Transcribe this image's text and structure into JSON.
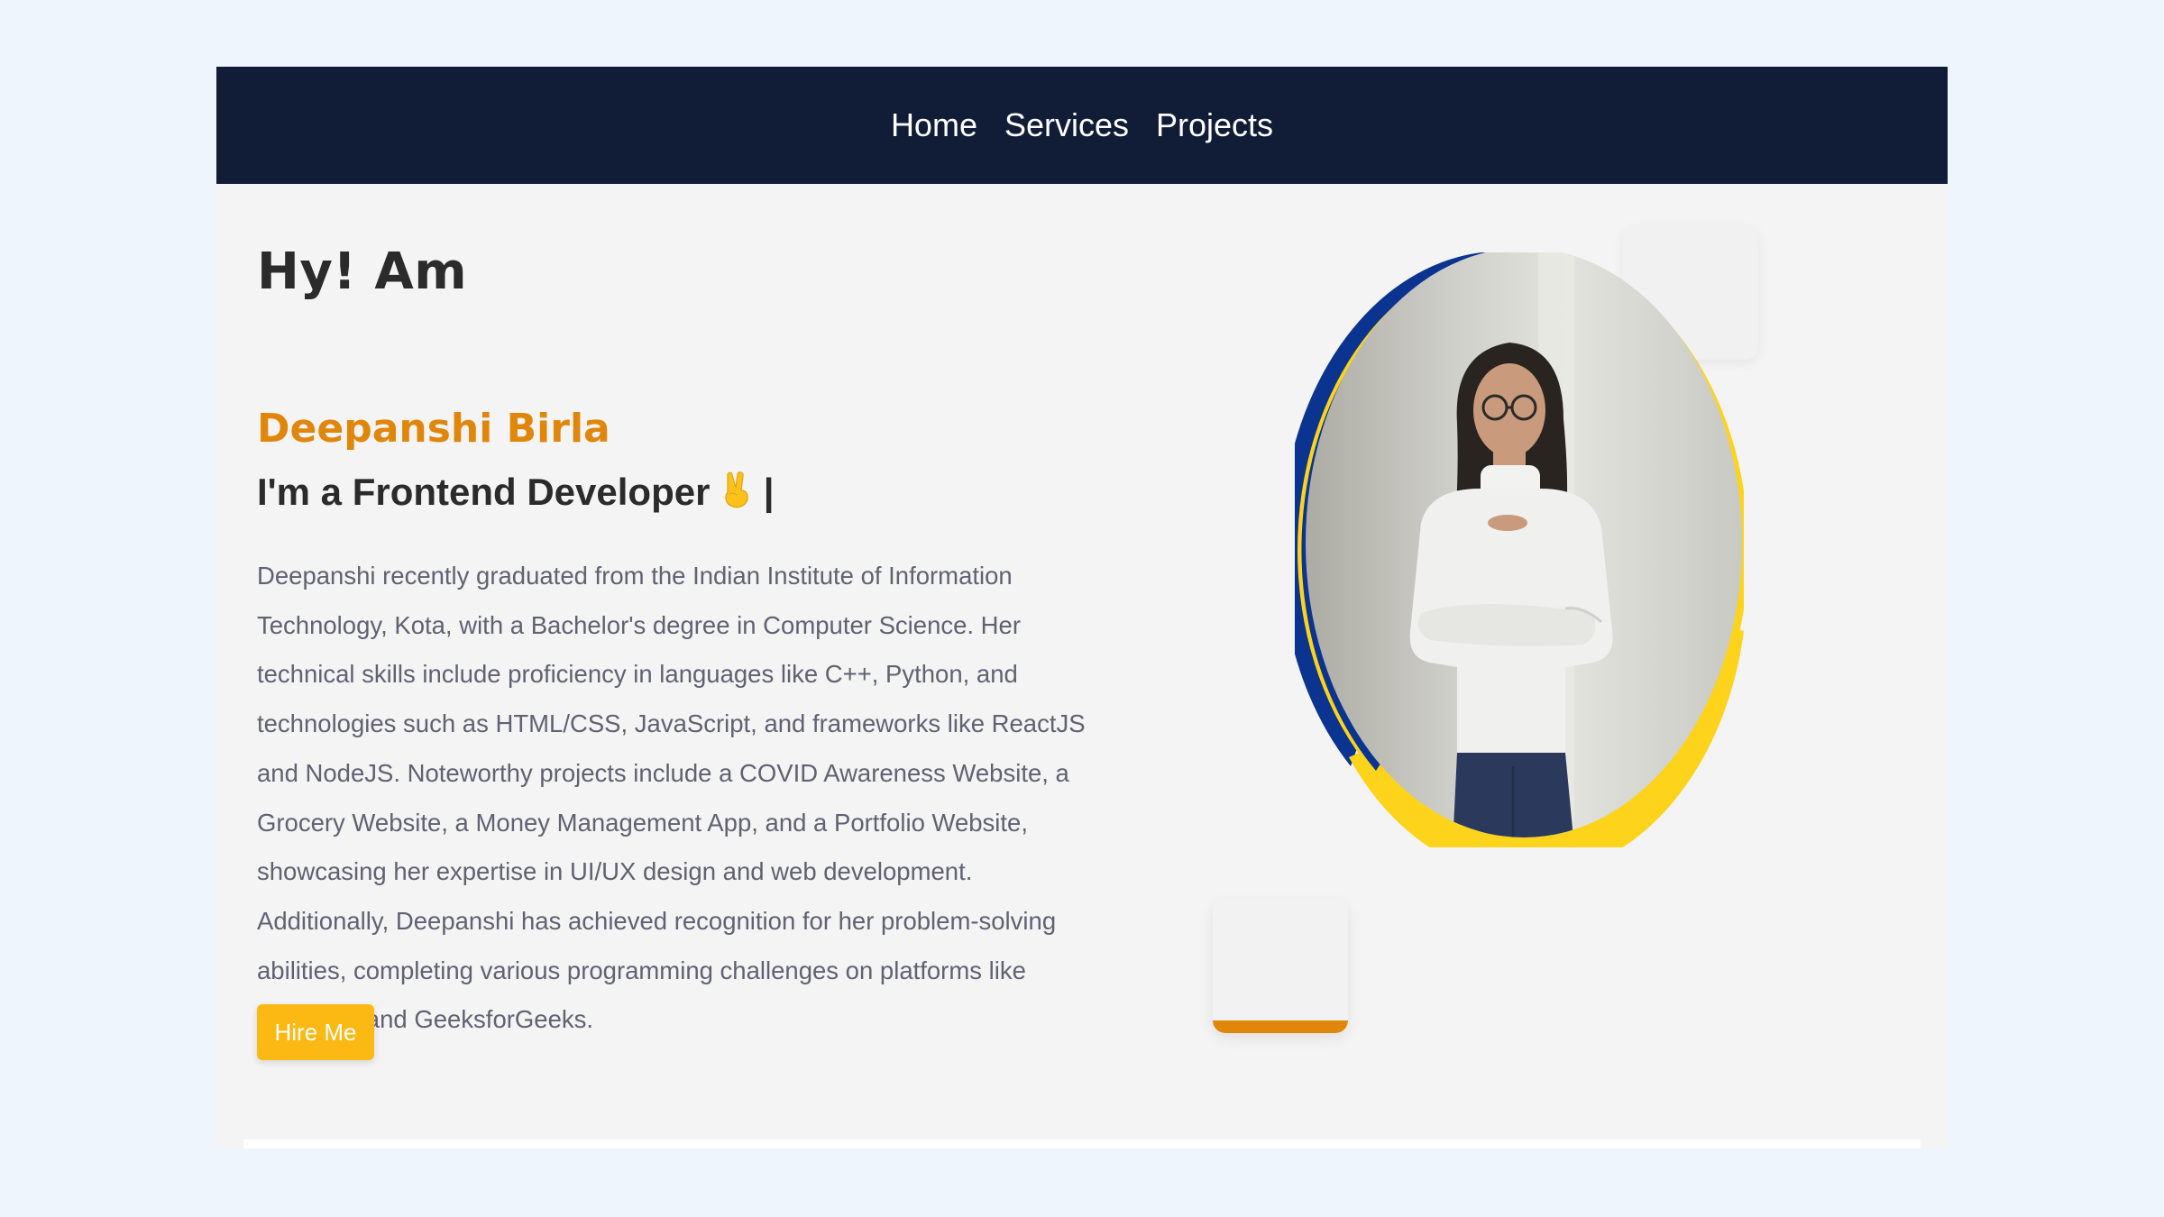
{
  "nav": {
    "items": [
      {
        "label": "Home"
      },
      {
        "label": "Services"
      },
      {
        "label": "Projects"
      }
    ]
  },
  "hero": {
    "greeting": "Hy! Am",
    "name": "Deepanshi Birla",
    "role_prefix": "I'm a ",
    "role_title": "Frontend Developer",
    "role_emoji": "✌",
    "role_cursor": "|",
    "bio": "Deepanshi recently graduated from the Indian Institute of Information Technology, Kota, with a Bachelor's degree in Computer Science. Her technical skills include proficiency in languages like C++, Python, and technologies such as HTML/CSS, JavaScript, and frameworks like ReactJS and NodeJS. Noteworthy projects include a COVID Awareness Website, a Grocery Website, a Money Management App, and a Portfolio Website, showcasing her expertise in UI/UX design and web development. Additionally, Deepanshi has achieved recognition for her problem-solving abilities, completing various programming challenges on platforms like Leetcode and GeeksforGeeks.",
    "cta_label": "Hire Me"
  },
  "colors": {
    "nav_bg": "#111d36",
    "accent_orange": "#e0870b",
    "button_yellow": "#fdb913",
    "ring_blue": "#0a3490",
    "ring_yellow": "#fdd31b"
  },
  "icons": {
    "emoji": "victory-hand-icon"
  }
}
